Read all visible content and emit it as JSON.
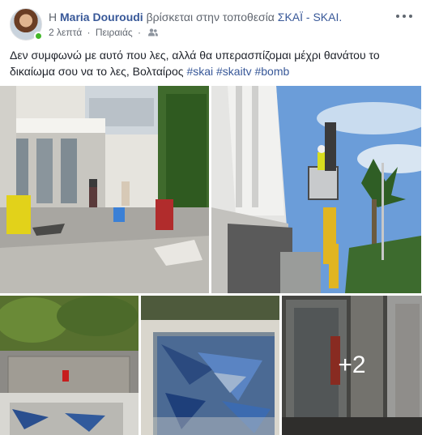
{
  "post": {
    "author_prefix": "Η",
    "author_name": "Maria Douroudi",
    "location_phrase": "βρίσκεται στην τοποθεσία",
    "location_name": "ΣΚΑΪ - SKAI.",
    "timestamp": "2 λεπτά",
    "place": "Πειραιάς",
    "audience_icon": "friends-icon",
    "more_icon": "more-options-icon",
    "text": "Δεν συμφωνώ με αυτό που λες, αλλά θα υπερασπίζομαι μέχρι θανάτου το δικαίωμα σου να το λες, Βολταίρος",
    "hashtags": [
      "#skai",
      "#skaitv",
      "#bomb"
    ]
  },
  "photos": {
    "count": 5,
    "more_label": "+2"
  },
  "colors": {
    "link": "#385898",
    "text": "#1d2129",
    "meta": "#616770",
    "online": "#42b72a"
  }
}
